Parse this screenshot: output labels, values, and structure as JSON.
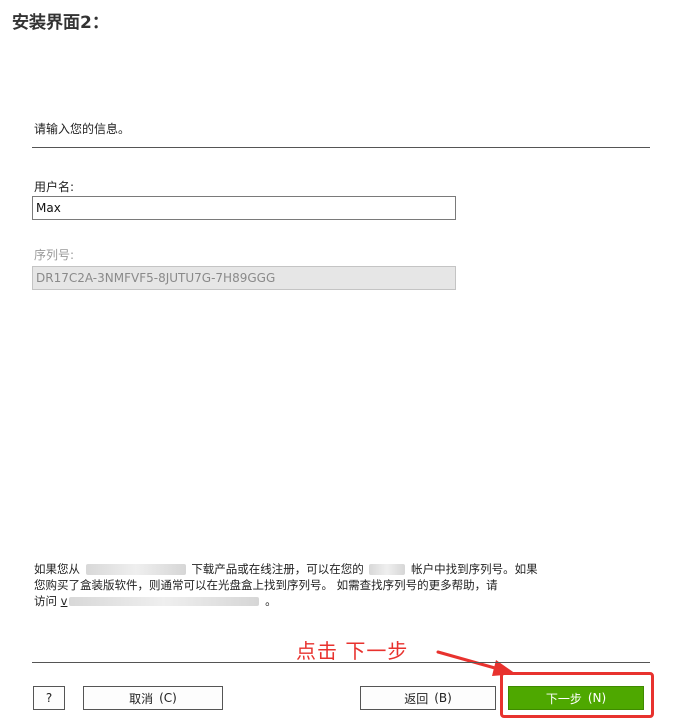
{
  "heading": "安装界面2：",
  "dialog": {
    "prompt": "请输入您的信息。",
    "username": {
      "label": "用户名:",
      "value": "Max"
    },
    "serial": {
      "label": "序列号:",
      "value": "DR17C2A-3NMFVF5-8JUTU7G-7H89GGG"
    },
    "help": {
      "line1_a": "如果您从",
      "line1_b": "下载产品或在线注册，可以在您的",
      "line1_c": "帐户中找到序列号。如果",
      "line2": "您购买了盒装版软件，则通常可以在光盘盒上找到序列号。 如需查找序列号的更多帮助，请",
      "line3_a": "访问",
      "line3_link": "v",
      "line3_b": "。"
    },
    "buttons": {
      "help": "?",
      "cancel": "取消",
      "cancel_key": "(C)",
      "back": "返回",
      "back_key": "(B)",
      "next": "下一步",
      "next_key": "(N)"
    },
    "colors": {
      "next_button": "#4ea800",
      "annotation": "#e8322e"
    }
  },
  "annotation": {
    "text": "点击 下一步"
  }
}
